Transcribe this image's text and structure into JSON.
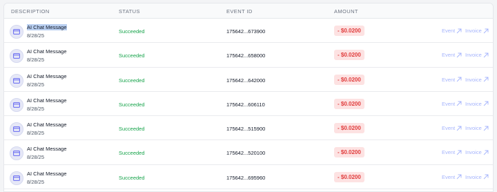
{
  "header": {
    "description": "DESCRIPTION",
    "status": "STATUS",
    "event_id": "EVENT ID",
    "amount": "AMOUNT"
  },
  "rows": [
    {
      "description": "AI Chat Message",
      "date": "8/28/25",
      "status": "Succeeded",
      "event_id": "175642...673900",
      "amount": "- $0.0200",
      "event_link": "Event",
      "invoice_link": "Invoice",
      "selected": true
    },
    {
      "description": "AI Chat Message",
      "date": "8/28/25",
      "status": "Succeeded",
      "event_id": "175642...658000",
      "amount": "- $0.0200",
      "event_link": "Event",
      "invoice_link": "Invoice"
    },
    {
      "description": "AI Chat Message",
      "date": "8/28/25",
      "status": "Succeeded",
      "event_id": "175642...642000",
      "amount": "- $0.0200",
      "event_link": "Event",
      "invoice_link": "Invoice"
    },
    {
      "description": "AI Chat Message",
      "date": "8/28/25",
      "status": "Succeeded",
      "event_id": "175642...606110",
      "amount": "- $0.0200",
      "event_link": "Event",
      "invoice_link": "Invoice"
    },
    {
      "description": "AI Chat Message",
      "date": "8/28/25",
      "status": "Succeeded",
      "event_id": "175642...515900",
      "amount": "- $0.0200",
      "event_link": "Event",
      "invoice_link": "Invoice"
    },
    {
      "description": "AI Chat Message",
      "date": "8/28/25",
      "status": "Succeeded",
      "event_id": "175642...520100",
      "amount": "- $0.0200",
      "event_link": "Event",
      "invoice_link": "Invoice"
    },
    {
      "description": "AI Chat Message",
      "date": "8/28/25",
      "status": "Succeeded",
      "event_id": "175642...695960",
      "amount": "- $0.0200",
      "event_link": "Event",
      "invoice_link": "Invoice"
    }
  ],
  "icons": {
    "row_icon": "credit-card-icon",
    "link_icon": "arrow-up-right-icon"
  },
  "colors": {
    "status": "#16a34a",
    "amount_text": "#e03b3b",
    "amount_bg": "#fde2e2",
    "link": "#a5b4fc",
    "selection": "#b9cff0"
  }
}
